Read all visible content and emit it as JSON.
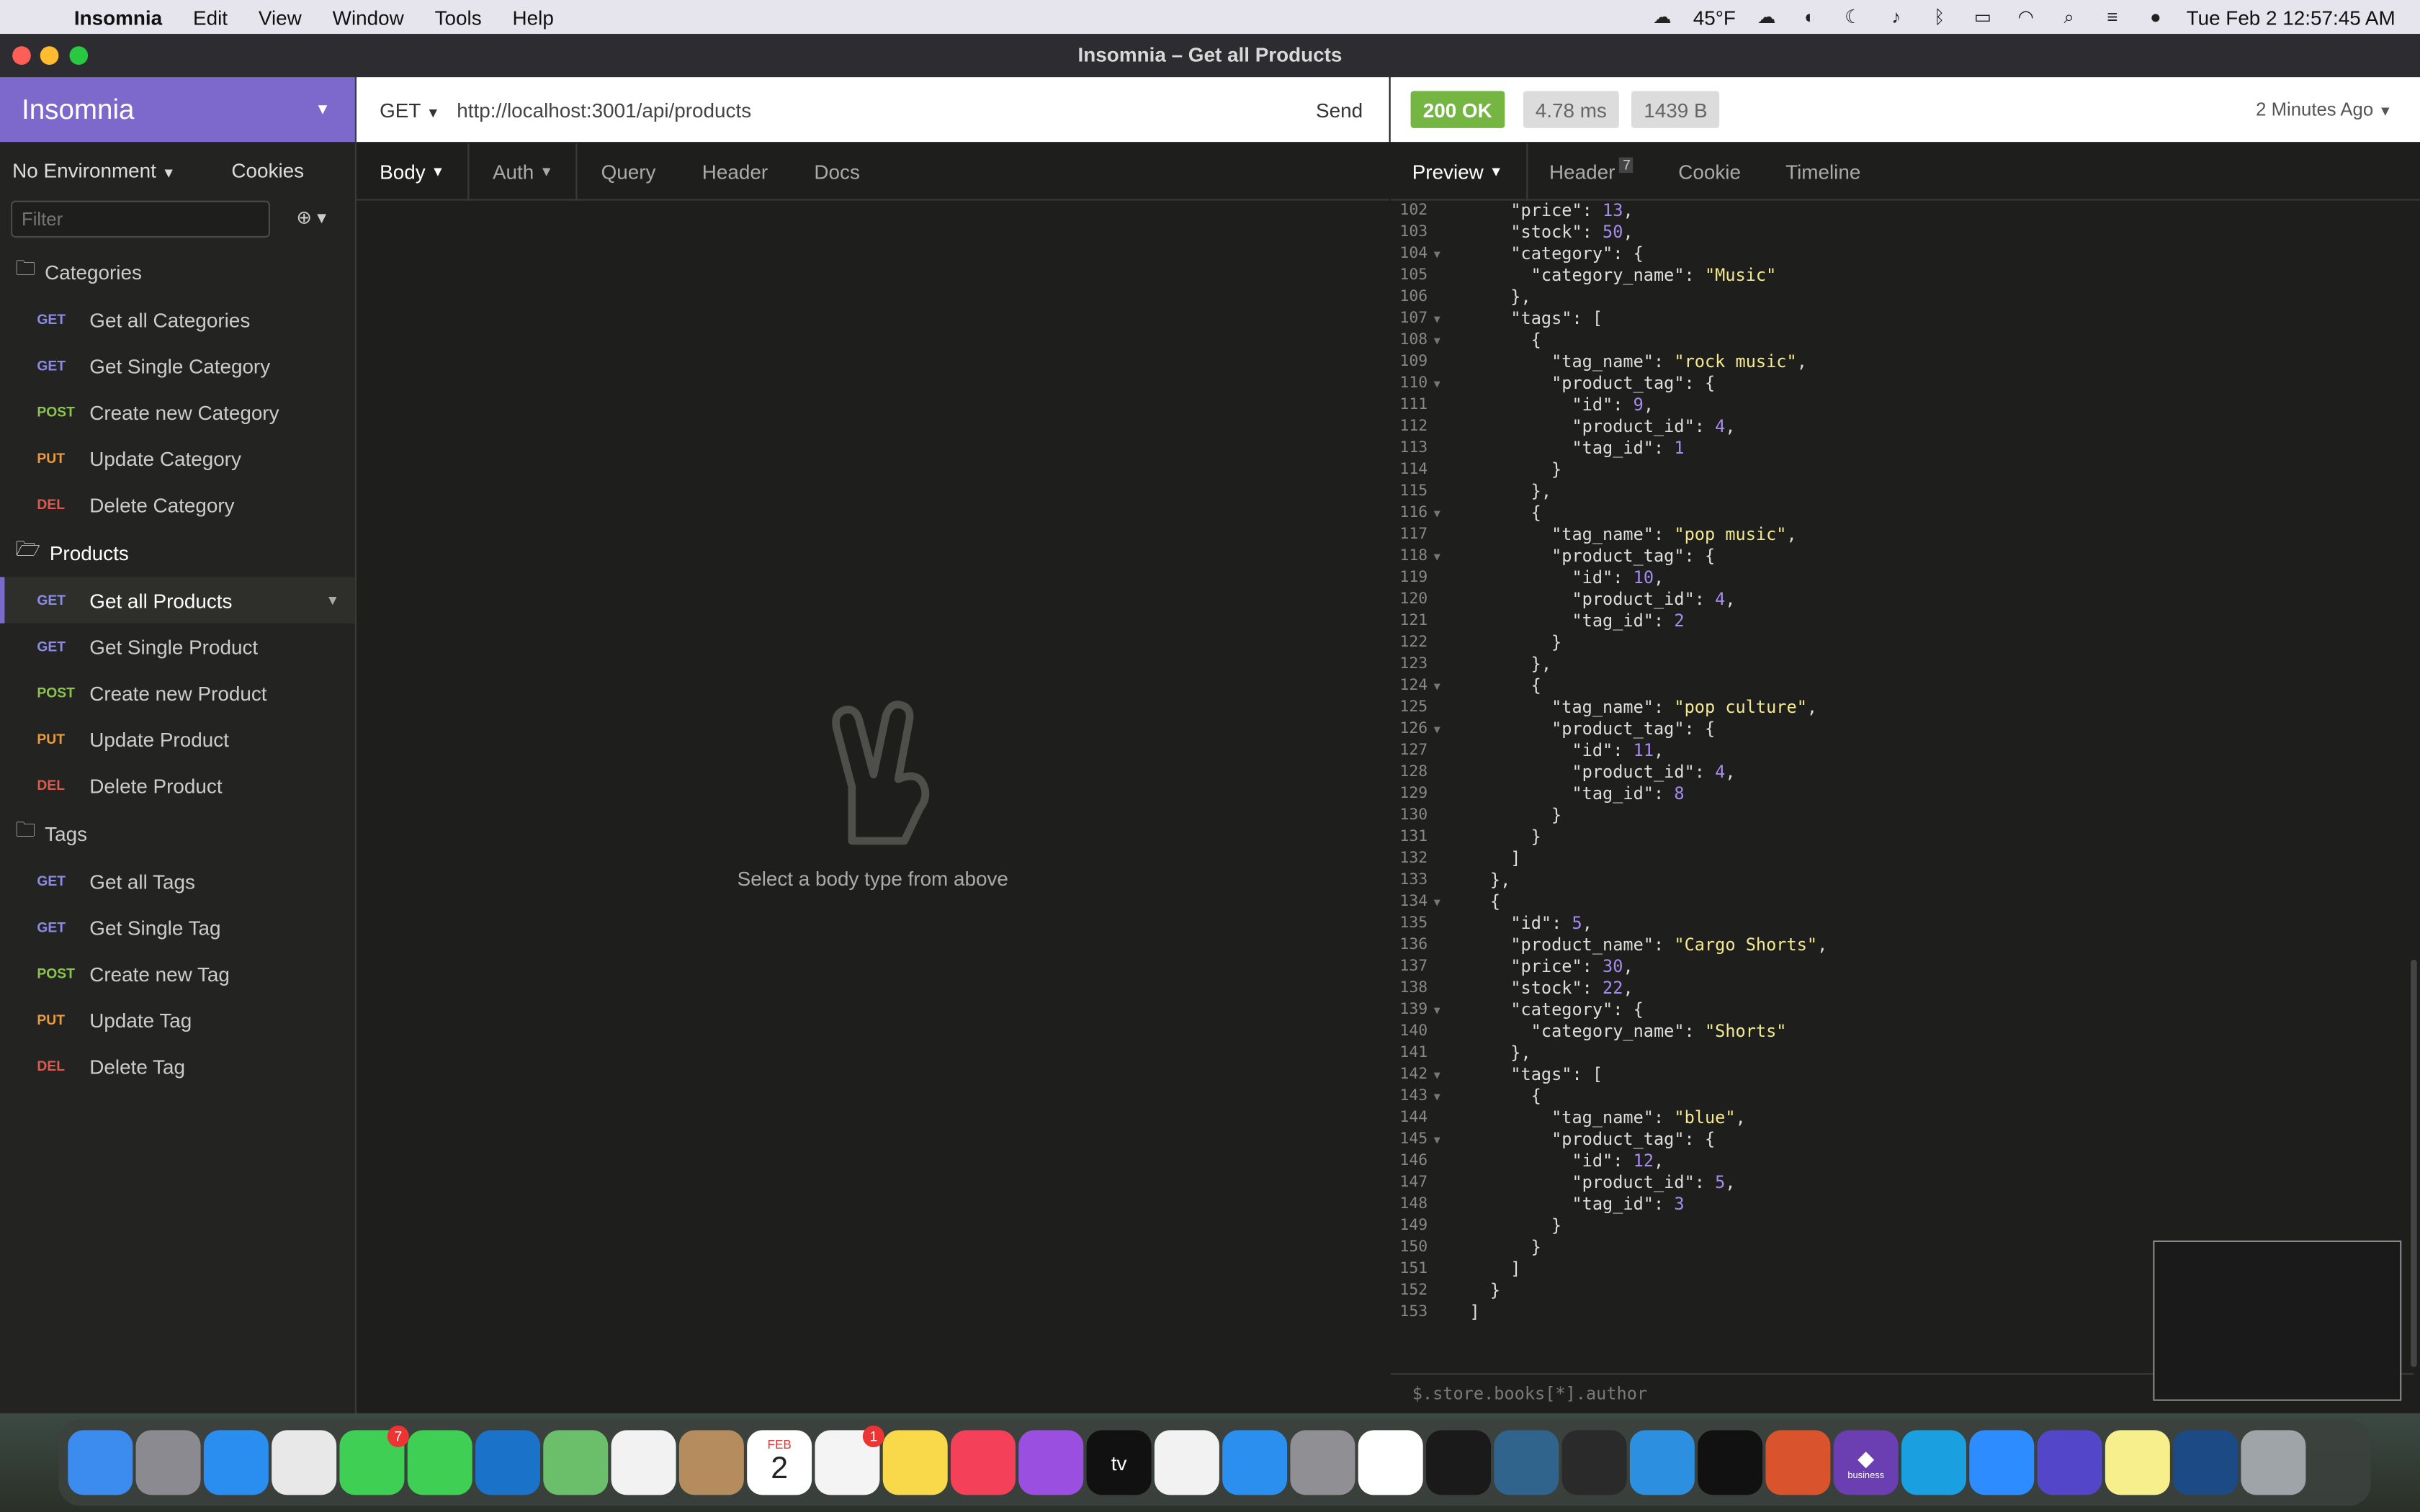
{
  "menubar": {
    "apple": "",
    "app": "Insomnia",
    "items": [
      "Edit",
      "View",
      "Window",
      "Tools",
      "Help"
    ],
    "weather": "45°F",
    "datetime": "Tue Feb 2  12:57:45 AM"
  },
  "window": {
    "title": "Insomnia – Get all Products"
  },
  "sidebar": {
    "brand": "Insomnia",
    "environment": "No Environment",
    "cookies": "Cookies",
    "filter_placeholder": "Filter",
    "folders": [
      {
        "name": "Categories",
        "requests": [
          {
            "method": "GET",
            "name": "Get all Categories"
          },
          {
            "method": "GET",
            "name": "Get Single Category"
          },
          {
            "method": "POST",
            "name": "Create new Category"
          },
          {
            "method": "PUT",
            "name": "Update Category"
          },
          {
            "method": "DEL",
            "name": "Delete Category"
          }
        ]
      },
      {
        "name": "Products",
        "requests": [
          {
            "method": "GET",
            "name": "Get all Products"
          },
          {
            "method": "GET",
            "name": "Get Single Product"
          },
          {
            "method": "POST",
            "name": "Create new Product"
          },
          {
            "method": "PUT",
            "name": "Update Product"
          },
          {
            "method": "DEL",
            "name": "Delete Product"
          }
        ]
      },
      {
        "name": "Tags",
        "requests": [
          {
            "method": "GET",
            "name": "Get all Tags"
          },
          {
            "method": "GET",
            "name": "Get Single Tag"
          },
          {
            "method": "POST",
            "name": "Create new Tag"
          },
          {
            "method": "PUT",
            "name": "Update Tag"
          },
          {
            "method": "DEL",
            "name": "Delete Tag"
          }
        ]
      }
    ]
  },
  "request": {
    "method": "GET",
    "url": "http://localhost:3001/api/products",
    "send": "Send",
    "tabs": [
      "Body",
      "Auth",
      "Query",
      "Header",
      "Docs"
    ],
    "empty_message": "Select a body type from above"
  },
  "response": {
    "status": "200 OK",
    "time": "4.78 ms",
    "size": "1439 B",
    "ago": "2 Minutes Ago",
    "tabs": [
      "Preview",
      "Header",
      "Cookie",
      "Timeline"
    ],
    "header_count": "7",
    "filter_query": "$.store.books[*].author",
    "lines": [
      [
        "102",
        "      \"price\": 13,"
      ],
      [
        "103",
        "      \"stock\": 50,"
      ],
      [
        "104",
        "      \"category\": {"
      ],
      [
        "105",
        "        \"category_name\": \"Music\""
      ],
      [
        "106",
        "      },"
      ],
      [
        "107",
        "      \"tags\": ["
      ],
      [
        "108",
        "        {"
      ],
      [
        "109",
        "          \"tag_name\": \"rock music\","
      ],
      [
        "110",
        "          \"product_tag\": {"
      ],
      [
        "111",
        "            \"id\": 9,"
      ],
      [
        "112",
        "            \"product_id\": 4,"
      ],
      [
        "113",
        "            \"tag_id\": 1"
      ],
      [
        "114",
        "          }"
      ],
      [
        "115",
        "        },"
      ],
      [
        "116",
        "        {"
      ],
      [
        "117",
        "          \"tag_name\": \"pop music\","
      ],
      [
        "118",
        "          \"product_tag\": {"
      ],
      [
        "119",
        "            \"id\": 10,"
      ],
      [
        "120",
        "            \"product_id\": 4,"
      ],
      [
        "121",
        "            \"tag_id\": 2"
      ],
      [
        "122",
        "          }"
      ],
      [
        "123",
        "        },"
      ],
      [
        "124",
        "        {"
      ],
      [
        "125",
        "          \"tag_name\": \"pop culture\","
      ],
      [
        "126",
        "          \"product_tag\": {"
      ],
      [
        "127",
        "            \"id\": 11,"
      ],
      [
        "128",
        "            \"product_id\": 4,"
      ],
      [
        "129",
        "            \"tag_id\": 8"
      ],
      [
        "130",
        "          }"
      ],
      [
        "131",
        "        }"
      ],
      [
        "132",
        "      ]"
      ],
      [
        "133",
        "    },"
      ],
      [
        "134",
        "    {"
      ],
      [
        "135",
        "      \"id\": 5,"
      ],
      [
        "136",
        "      \"product_name\": \"Cargo Shorts\","
      ],
      [
        "137",
        "      \"price\": 30,"
      ],
      [
        "138",
        "      \"stock\": 22,"
      ],
      [
        "139",
        "      \"category\": {"
      ],
      [
        "140",
        "        \"category_name\": \"Shorts\""
      ],
      [
        "141",
        "      },"
      ],
      [
        "142",
        "      \"tags\": ["
      ],
      [
        "143",
        "        {"
      ],
      [
        "144",
        "          \"tag_name\": \"blue\","
      ],
      [
        "145",
        "          \"product_tag\": {"
      ],
      [
        "146",
        "            \"id\": 12,"
      ],
      [
        "147",
        "            \"product_id\": 5,"
      ],
      [
        "148",
        "            \"tag_id\": 3"
      ],
      [
        "149",
        "          }"
      ],
      [
        "150",
        "        }"
      ],
      [
        "151",
        "      ]"
      ],
      [
        "152",
        "    }"
      ],
      [
        "153",
        "  ]"
      ]
    ],
    "fold_lines": [
      "104",
      "107",
      "108",
      "110",
      "116",
      "118",
      "124",
      "126",
      "134",
      "139",
      "142",
      "143",
      "145"
    ]
  },
  "dock": {
    "apps": [
      {
        "icon": "finder-icon",
        "bg": "#3c8cf0"
      },
      {
        "icon": "launchpad-icon",
        "bg": "#8a8a90"
      },
      {
        "icon": "safari-icon",
        "bg": "#2a8ef0"
      },
      {
        "icon": "chrome-icon",
        "bg": "#e8e8e8"
      },
      {
        "icon": "messages-icon",
        "bg": "#3fcf55",
        "badge": "7"
      },
      {
        "icon": "facetime-icon",
        "bg": "#3fcf55"
      },
      {
        "icon": "outlook-icon",
        "bg": "#1a73c9"
      },
      {
        "icon": "maps-icon",
        "bg": "#6cbf6a"
      },
      {
        "icon": "photos-icon",
        "bg": "#f2f2f2"
      },
      {
        "icon": "contacts-icon",
        "bg": "#b58c5e"
      },
      {
        "icon": "calendar-icon",
        "bg": "#ffffff"
      },
      {
        "icon": "reminders-icon",
        "bg": "#f4f4f4",
        "badge": "1"
      },
      {
        "icon": "notes-icon",
        "bg": "#f9d94a"
      },
      {
        "icon": "music-icon",
        "bg": "#f5405a"
      },
      {
        "icon": "podcasts-icon",
        "bg": "#9a4fe0"
      },
      {
        "icon": "tv-icon",
        "bg": "#111111"
      },
      {
        "icon": "news-icon",
        "bg": "#f2f2f2"
      },
      {
        "icon": "appstore-icon",
        "bg": "#2b8ff0"
      },
      {
        "icon": "settings-icon",
        "bg": "#8f8f94"
      },
      {
        "icon": "slack-icon",
        "bg": "#ffffff"
      },
      {
        "icon": "github-icon",
        "bg": "#1a1a1a"
      },
      {
        "icon": "postgres-icon",
        "bg": "#31648c"
      },
      {
        "icon": "update-icon",
        "bg": "#2a2a2a"
      },
      {
        "icon": "vscode-icon",
        "bg": "#2d8fe0"
      },
      {
        "icon": "terminal-icon",
        "bg": "#111111"
      },
      {
        "icon": "remote-desktop-icon",
        "bg": "#d9532c"
      },
      {
        "icon": "insomnia-icon",
        "bg": "#6b3fb2"
      },
      {
        "icon": "skype-icon",
        "bg": "#1aa0e0"
      },
      {
        "icon": "zoom-icon",
        "bg": "#2d8cff"
      },
      {
        "icon": "screen-icon",
        "bg": "#5346c8"
      },
      {
        "icon": "stickies-icon",
        "bg": "#f7ee8c"
      },
      {
        "icon": "preview-icon",
        "bg": "#1c4a85"
      },
      {
        "icon": "trash-icon",
        "bg": "#9fa4a8"
      }
    ],
    "calendar_month": "FEB",
    "calendar_day": "2",
    "tv_label": "tv",
    "insomnia_label": "business"
  }
}
